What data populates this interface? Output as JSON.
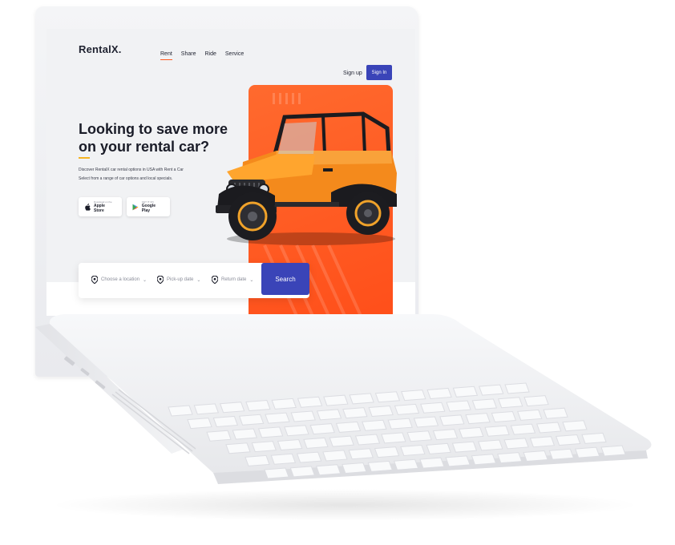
{
  "brand": {
    "logo": "RentalX."
  },
  "nav": {
    "items": [
      "Rent",
      "Share",
      "Ride",
      "Service"
    ]
  },
  "auth": {
    "signup": "Sign up",
    "signin": "Sign In"
  },
  "hero": {
    "title_line1": "Looking to save more",
    "title_line2": "on your rental car?",
    "desc_line1": "Discover RentalX car rental options in USA with  Rent a Car",
    "desc_line2": "Select from a range of car options and local specials."
  },
  "stores": {
    "apple_small": "Download on the",
    "apple_big": "Apple Store",
    "google_small": "GET IT ON",
    "google_big": "Google Play"
  },
  "search": {
    "location": "Choose a location",
    "pickup": "Pick-up date",
    "return": "Return date",
    "button": "Search"
  },
  "colors": {
    "brand_blue": "#3a44b8",
    "accent_orange": "#ff5a1f",
    "accent_yellow": "#f5b321"
  }
}
